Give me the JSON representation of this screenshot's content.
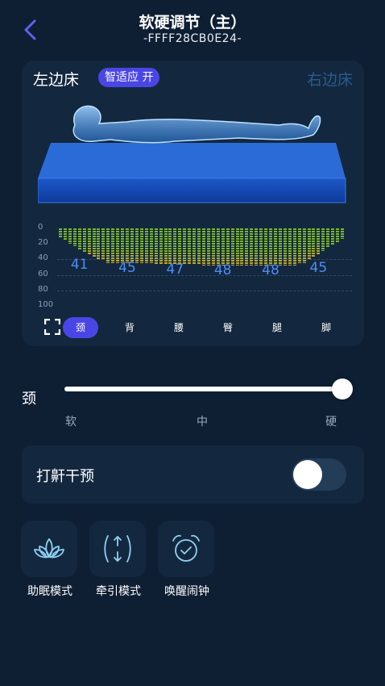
{
  "header": {
    "back_icon": "chevron-left-icon",
    "title": "软硬调节（主）",
    "subtitle": "-FFFF28CB0E24-"
  },
  "bed_card": {
    "left_label": "左边床",
    "smart_badge": "智适应 开",
    "right_label": "右边床",
    "y_ticks": [
      "0",
      "20",
      "40",
      "60",
      "80",
      "100"
    ],
    "segments": [
      {
        "label": "颈",
        "value": "41"
      },
      {
        "label": "背",
        "value": "45"
      },
      {
        "label": "腰",
        "value": "47"
      },
      {
        "label": "臀",
        "value": "48"
      },
      {
        "label": "腿",
        "value": "48"
      },
      {
        "label": "脚",
        "value": "45"
      }
    ],
    "active_segment": "颈",
    "expand_icon": "expand-icon"
  },
  "chart_data": {
    "type": "bar",
    "categories": [
      "颈",
      "背",
      "腰",
      "臀",
      "腿",
      "脚"
    ],
    "values": [
      41,
      45,
      47,
      48,
      48,
      45
    ],
    "ylim": [
      0,
      100
    ],
    "y_ticks": [
      0,
      20,
      40,
      60,
      80,
      100
    ],
    "y_inverted": true,
    "grid": true,
    "colors": {
      "low": "#7bb62a",
      "high": "#c9a624"
    }
  },
  "slider": {
    "label": "颈",
    "value_fraction": 1.0,
    "ticks": [
      "软",
      "中",
      "硬"
    ]
  },
  "snore": {
    "label": "打鼾干预",
    "enabled": false
  },
  "modes": [
    {
      "label": "助眠模式",
      "icon": "lotus-icon"
    },
    {
      "label": "牵引模式",
      "icon": "traction-icon"
    },
    {
      "label": "唤醒闹钟",
      "icon": "alarm-clock-icon"
    }
  ],
  "colors": {
    "background": "#0e1f33",
    "card": "#13283f",
    "accent": "#4a46e6",
    "value_blue": "#4d8cf4"
  }
}
